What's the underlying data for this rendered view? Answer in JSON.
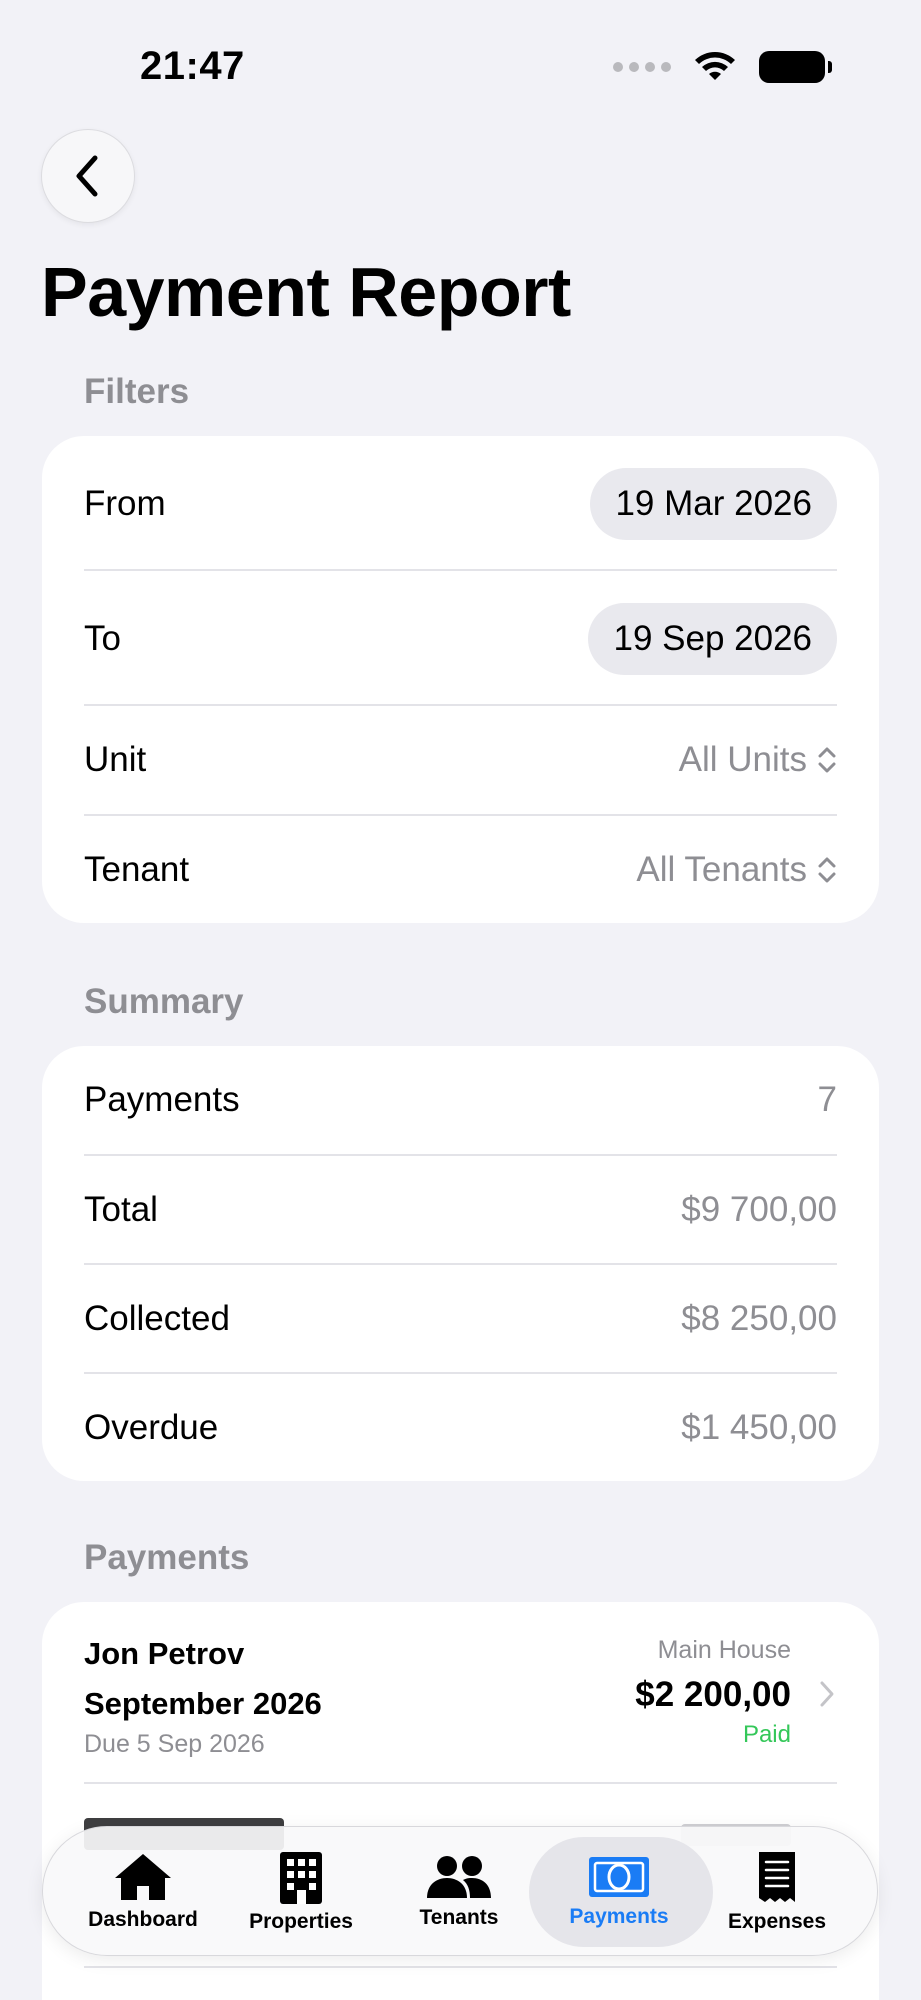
{
  "status_bar": {
    "time": "21:47"
  },
  "page": {
    "title": "Payment Report"
  },
  "filters": {
    "header": "Filters",
    "from_label": "From",
    "from_value": "19 Mar 2026",
    "to_label": "To",
    "to_value": "19 Sep 2026",
    "unit_label": "Unit",
    "unit_value": "All Units",
    "tenant_label": "Tenant",
    "tenant_value": "All Tenants"
  },
  "summary": {
    "header": "Summary",
    "rows": [
      {
        "label": "Payments",
        "value": "7"
      },
      {
        "label": "Total",
        "value": "$9 700,00"
      },
      {
        "label": "Collected",
        "value": "$8 250,00"
      },
      {
        "label": "Overdue",
        "value": "$1 450,00"
      }
    ]
  },
  "payments": {
    "header": "Payments",
    "items": [
      {
        "tenant": "Jon Petrov",
        "period": "September 2026",
        "due": "Due 5 Sep 2026",
        "unit": "Main House",
        "amount": "$2 200,00",
        "status": "Paid",
        "status_color": "#34c759"
      }
    ]
  },
  "tab_bar": {
    "active": "Payments",
    "active_color": "#1a7cf5",
    "tabs": [
      {
        "label": "Dashboard",
        "icon": "house-icon"
      },
      {
        "label": "Properties",
        "icon": "building-icon"
      },
      {
        "label": "Tenants",
        "icon": "people-icon"
      },
      {
        "label": "Payments",
        "icon": "banknote-icon"
      },
      {
        "label": "Expenses",
        "icon": "receipt-icon"
      }
    ]
  }
}
